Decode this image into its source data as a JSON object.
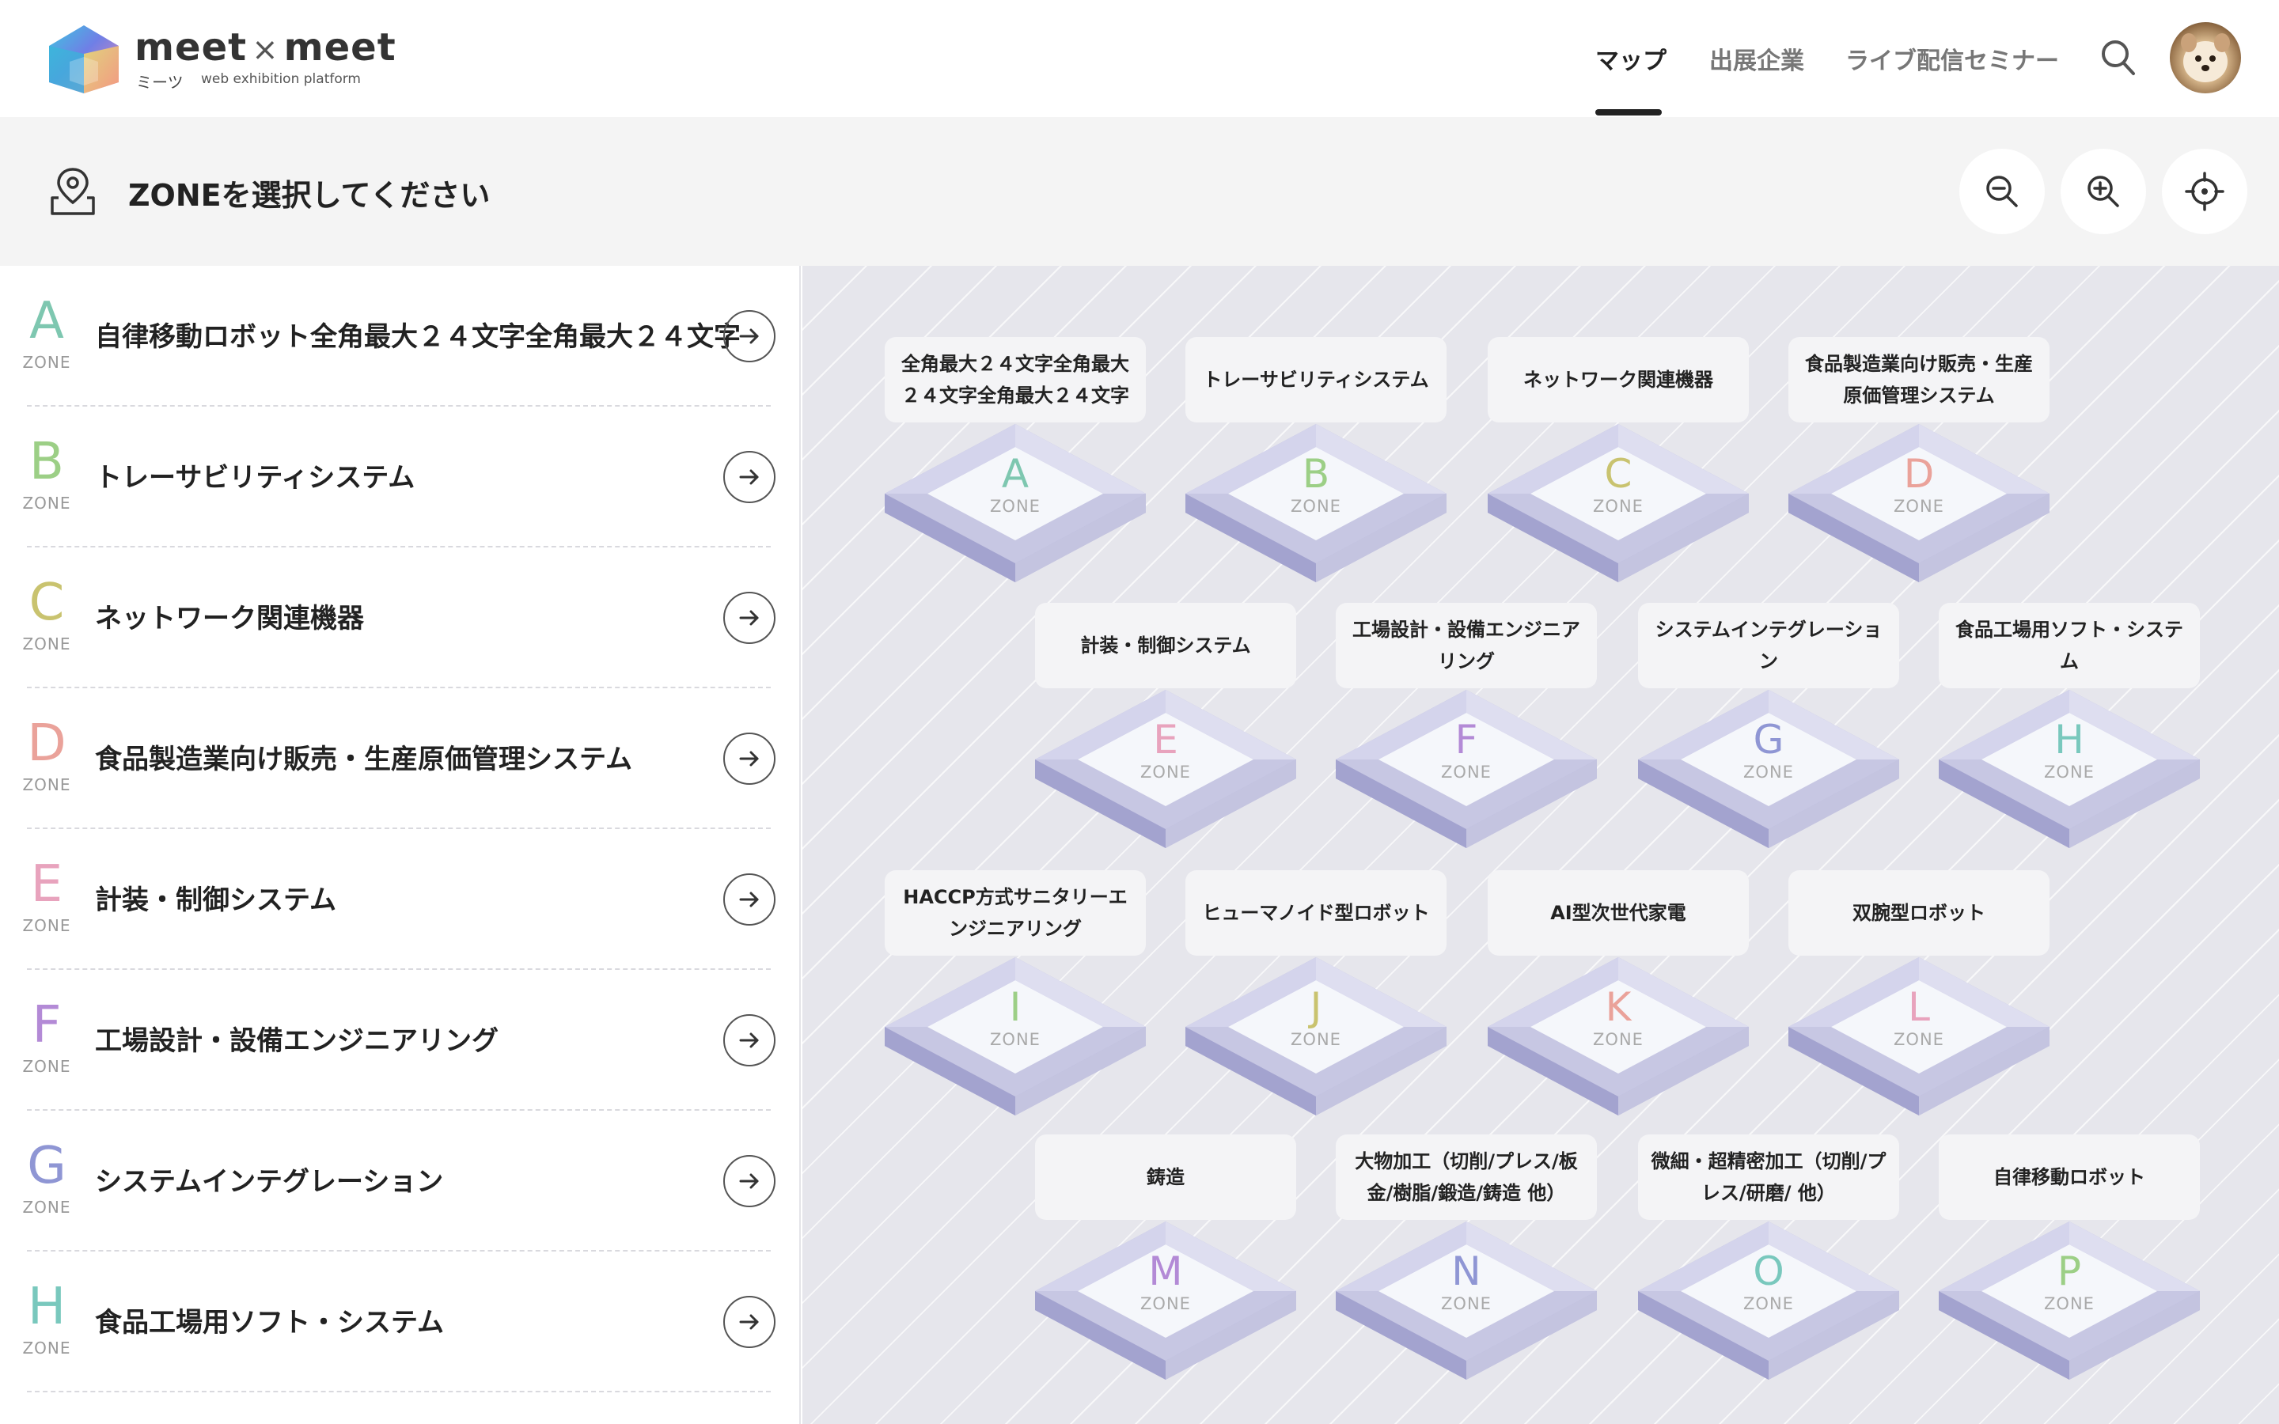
{
  "brand": {
    "name_left": "meet",
    "name_x": "×",
    "name_right": "meet",
    "sub_jp": "ミーツ",
    "sub_en": "web exhibition platform"
  },
  "nav": {
    "map": "マップ",
    "exhibitors": "出展企業",
    "live": "ライブ配信セミナー"
  },
  "subbar": {
    "title": "ZONEを選択してください"
  },
  "zone_word": "ZONE",
  "colors": {
    "A": "#7ec7b0",
    "B": "#9ccf86",
    "C": "#c9c36f",
    "D": "#eaa29a",
    "E": "#e8a3bd",
    "F": "#b38ad6",
    "G": "#8f96d4",
    "H": "#79c8bd",
    "I": "#9ccf86",
    "J": "#c9c36f",
    "K": "#eaa29a",
    "L": "#e8a3bd",
    "M": "#b38ad6",
    "N": "#8f96d4",
    "O": "#79c8bd",
    "P": "#9ccf86"
  },
  "list": [
    {
      "letter": "A",
      "name": "自律移動ロボット全角最大２４文字全角最大２４文字"
    },
    {
      "letter": "B",
      "name": "トレーサビリティシステム"
    },
    {
      "letter": "C",
      "name": "ネットワーク関連機器"
    },
    {
      "letter": "D",
      "name": "食品製造業向け販売・生産原価管理システム"
    },
    {
      "letter": "E",
      "name": "計装・制御システム"
    },
    {
      "letter": "F",
      "name": "工場設計・設備エンジニアリング"
    },
    {
      "letter": "G",
      "name": "システムインテグレーション"
    },
    {
      "letter": "H",
      "name": "食品工場用ソフト・システム"
    }
  ],
  "map": [
    {
      "letter": "A",
      "label": "全角最大２４文字全角最大２４文字全角最大２４文字"
    },
    {
      "letter": "B",
      "label": "トレーサビリティシステム"
    },
    {
      "letter": "C",
      "label": "ネットワーク関連機器"
    },
    {
      "letter": "D",
      "label": "食品製造業向け販売・生産原価管理システム"
    },
    {
      "letter": "E",
      "label": "計装・制御システム"
    },
    {
      "letter": "F",
      "label": "工場設計・設備エンジニアリング"
    },
    {
      "letter": "G",
      "label": "システムインテグレーション"
    },
    {
      "letter": "H",
      "label": "食品工場用ソフト・システム"
    },
    {
      "letter": "I",
      "label": "HACCP方式サニタリーエンジニアリング"
    },
    {
      "letter": "J",
      "label": "ヒューマノイド型ロボット"
    },
    {
      "letter": "K",
      "label": "AI型次世代家電"
    },
    {
      "letter": "L",
      "label": "双腕型ロボット"
    },
    {
      "letter": "M",
      "label": "鋳造"
    },
    {
      "letter": "N",
      "label": "大物加工（切削/プレス/板金/樹脂/鍛造/鋳造 他）"
    },
    {
      "letter": "O",
      "label": "微細・超精密加工（切削/プレス/研磨/ 他）"
    },
    {
      "letter": "P",
      "label": "自律移動ロボット"
    }
  ],
  "icons": [
    "location-pin-icon",
    "zoom-out-icon",
    "zoom-in-icon",
    "crosshair-icon",
    "search-icon",
    "arrow-right-icon"
  ]
}
